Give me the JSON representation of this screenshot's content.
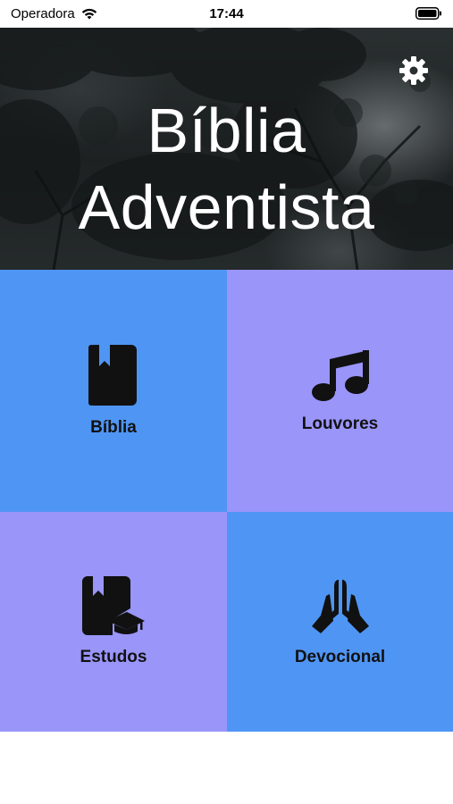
{
  "status_bar": {
    "carrier": "Operadora",
    "time": "17:44",
    "wifi_icon": "wifi-icon",
    "battery_icon": "battery-icon"
  },
  "hero": {
    "title_line1": "Bíblia",
    "title_line2": "Adventista",
    "settings_icon": "gear-icon"
  },
  "menu": {
    "items": [
      {
        "label": "Bíblia",
        "icon": "book-icon",
        "color": "#4f95f4"
      },
      {
        "label": "Louvores",
        "icon": "music-note-icon",
        "color": "#9a95f9"
      },
      {
        "label": "Estudos",
        "icon": "book-graduation-cap-icon",
        "color": "#9a95f9"
      },
      {
        "label": "Devocional",
        "icon": "praying-hands-icon",
        "color": "#4f95f4"
      }
    ]
  }
}
